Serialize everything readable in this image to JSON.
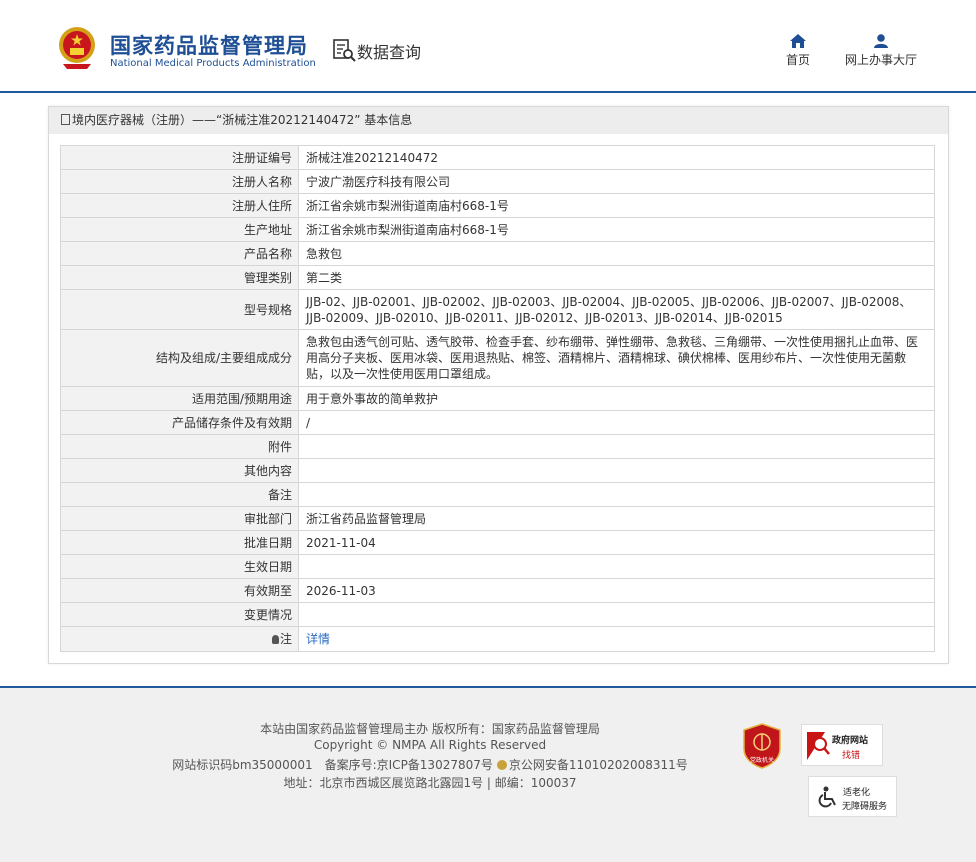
{
  "header": {
    "logo_cn": "国家药品监督管理局",
    "logo_en": "National Medical Products Administration",
    "data_query": "数据查询",
    "nav": [
      {
        "label": "首页",
        "icon": "home-icon"
      },
      {
        "label": "网上办事大厅",
        "icon": "user-icon"
      }
    ]
  },
  "breadcrumb": {
    "text": "境内医疗器械（注册）——“浙械注准20212140472” 基本信息"
  },
  "detail": {
    "rows": [
      {
        "label": "注册证编号",
        "value": "浙械注准20212140472"
      },
      {
        "label": "注册人名称",
        "value": "宁波广渤医疗科技有限公司"
      },
      {
        "label": "注册人住所",
        "value": "浙江省余姚市梨洲街道南庙村668-1号"
      },
      {
        "label": "生产地址",
        "value": "浙江省余姚市梨洲街道南庙村668-1号"
      },
      {
        "label": "产品名称",
        "value": "急救包"
      },
      {
        "label": "管理类别",
        "value": "第二类"
      },
      {
        "label": "型号规格",
        "value": "JJB-02、JJB-02001、JJB-02002、JJB-02003、JJB-02004、JJB-02005、JJB-02006、JJB-02007、JJB-02008、JJB-02009、JJB-02010、JJB-02011、JJB-02012、JJB-02013、JJB-02014、JJB-02015"
      },
      {
        "label": "结构及组成/主要组成成分",
        "value": "急救包由透气创可贴、透气胶带、检查手套、纱布绷带、弹性绷带、急救毯、三角绷带、一次性使用捆扎止血带、医用高分子夹板、医用冰袋、医用退热贴、棉签、酒精棉片、酒精棉球、碘伏棉棒、医用纱布片、一次性使用无菌敷贴，以及一次性使用医用口罩组成。"
      },
      {
        "label": "适用范围/预期用途",
        "value": "用于意外事故的简单救护"
      },
      {
        "label": "产品储存条件及有效期",
        "value": "/"
      },
      {
        "label": "附件",
        "value": ""
      },
      {
        "label": "其他内容",
        "value": ""
      },
      {
        "label": "备注",
        "value": ""
      },
      {
        "label": "审批部门",
        "value": "浙江省药品监督管理局"
      },
      {
        "label": "批准日期",
        "value": "2021-11-04"
      },
      {
        "label": "生效日期",
        "value": ""
      },
      {
        "label": "有效期至",
        "value": "2026-11-03"
      },
      {
        "label": "变更情况",
        "value": ""
      },
      {
        "label": "注",
        "value": "详情"
      }
    ]
  },
  "footer": {
    "line1": "本站由国家药品监督管理局主办 版权所有：国家药品监督管理局",
    "line2": "Copyright © NMPA All Rights Reserved",
    "line3a": "网站标识码bm35000001　备案序号:京ICP备13027807号",
    "line3b": "京公网安备11010202008311号",
    "line4": "地址：北京市西城区展览路北露园1号 | 邮编：100037",
    "badge_party": "党政机关",
    "badge_wzzc_1": "政府网站",
    "badge_wzzc_2": "找错",
    "badge_aged_1": "适老化",
    "badge_aged_2": "无障碍服务"
  },
  "colors": {
    "brand_blue": "#1e4f95",
    "link": "#2a6ac2"
  }
}
